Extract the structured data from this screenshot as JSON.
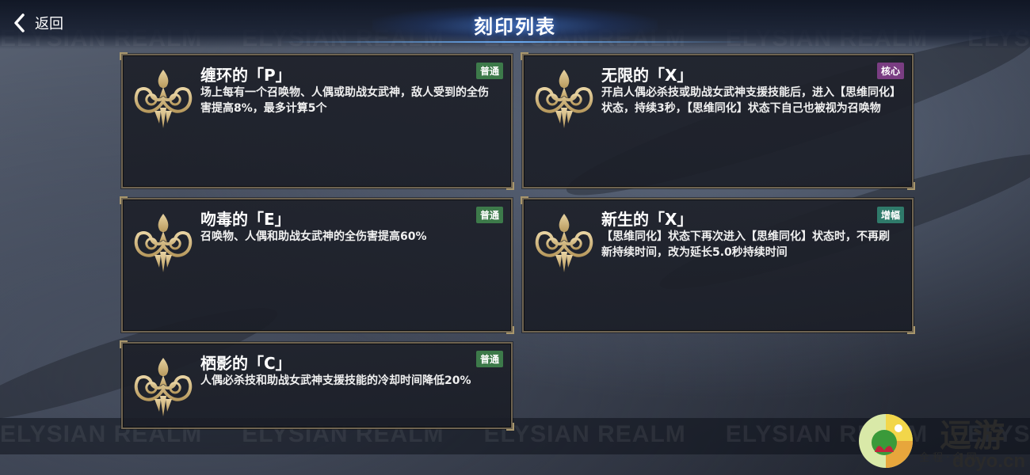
{
  "header": {
    "title": "刻印列表",
    "back_label": "返回"
  },
  "watermark": {
    "text": "ELYSIAN REALM"
  },
  "badge_colors": {
    "普通": "#3d7a4a",
    "核心": "#7a3d82",
    "增幅": "#2f7a6a"
  },
  "cards": [
    {
      "name": "缠环的「P」",
      "badge": "普通",
      "description": "场上每有一个召唤物、人偶或助战女武神，敌人受到的全伤害提高8%，最多计算5个"
    },
    {
      "name": "无限的「X」",
      "badge": "核心",
      "description": "开启人偶必杀技或助战女武神支援技能后，进入【思维同化】状态，持续3秒，【思维同化】状态下自己也被视为召唤物"
    },
    {
      "name": "吻毒的「E」",
      "badge": "普通",
      "description": "召唤物、人偶和助战女武神的全伤害提高60%"
    },
    {
      "name": "新生的「X」",
      "badge": "增幅",
      "description": "【思维同化】状态下再次进入【思维同化】状态时，不再刷新持续时间，改为延长5.0秒持续时间"
    },
    {
      "name": "栖影的「C」",
      "badge": "普通",
      "description": "人偶必杀技和助战女武神支援技能的冷却时间降低20%"
    }
  ],
  "site_logo": {
    "big_text": "逗游",
    "small_text": "全 程 · 全 网",
    "url_text": "doyo.cn"
  }
}
